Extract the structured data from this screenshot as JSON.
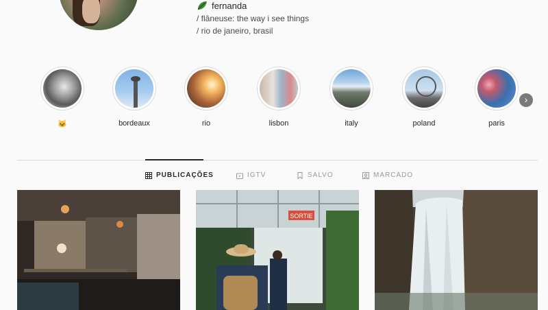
{
  "profile": {
    "name": "fernanda",
    "bio_lines": [
      "/ flâneuse: the way i see things",
      "/ rio de janeiro, brasil"
    ]
  },
  "highlights": [
    {
      "label": "🐱",
      "icon": "cat-face"
    },
    {
      "label": "bordeaux"
    },
    {
      "label": "rio"
    },
    {
      "label": "lisbon"
    },
    {
      "label": "italy"
    },
    {
      "label": "poland"
    },
    {
      "label": "paris"
    }
  ],
  "tabs": [
    {
      "label": "PUBLICAÇÕES",
      "icon": "grid-icon",
      "active": true
    },
    {
      "label": "IGTV",
      "icon": "tv-icon",
      "active": false
    },
    {
      "label": "SALVO",
      "icon": "bookmark-icon",
      "active": false
    },
    {
      "label": "MARCADO",
      "icon": "tag-icon",
      "active": false
    }
  ],
  "posts": [
    {
      "subject": "café interior"
    },
    {
      "subject": "greenhouse with sortie sign",
      "sign_text": "SORTIE"
    },
    {
      "subject": "waterfall"
    }
  ],
  "colors": {
    "accent": "#262626",
    "muted": "#999999",
    "border": "#dbdbdb",
    "background": "#fafafa"
  }
}
